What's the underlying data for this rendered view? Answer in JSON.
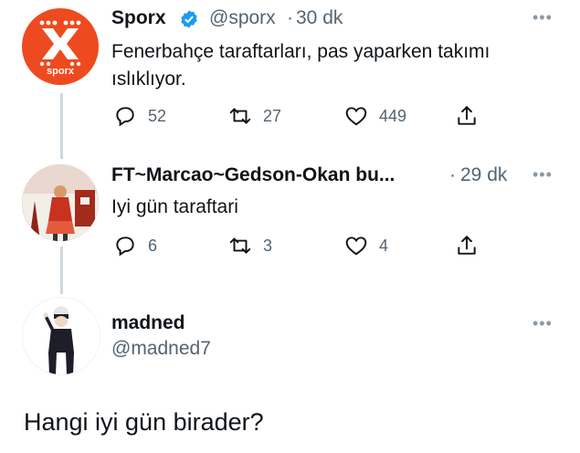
{
  "tweets": [
    {
      "name": "Sporx",
      "handle": "@sporx",
      "time": "30 dk",
      "verified": true,
      "text": "Fenerbahçe taraftarları, pas yaparken takımı ıslıklıyor.",
      "avatar_logo": "sporx",
      "replies": "52",
      "retweets": "27",
      "likes": "449"
    },
    {
      "name": "FT~Marcao~Gedson-Okan bu...",
      "time": "29 dk",
      "text": "Iyi gün taraftari",
      "replies": "6",
      "retweets": "3",
      "likes": "4"
    },
    {
      "name": "madned",
      "handle": "@madned7",
      "text": "Hangi iyi gün birader?"
    }
  ],
  "icons": {
    "reply": "reply-icon",
    "retweet": "retweet-icon",
    "like": "heart-icon",
    "share": "share-icon",
    "more": "more-icon",
    "verified": "verified-badge-icon"
  },
  "colors": {
    "sporx_orange": "#ee4a1f",
    "verified_blue": "#1d9bf0",
    "secondary_text": "#536471",
    "thread_line": "#cfd9de"
  }
}
